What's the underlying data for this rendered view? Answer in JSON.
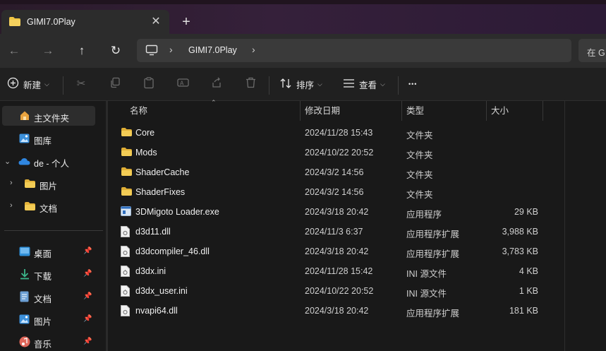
{
  "tab": {
    "title": "GIMI7.0Play",
    "close": "✕",
    "new_tab": "+"
  },
  "nav": {
    "back": "←",
    "forward": "→",
    "up": "↑",
    "refresh": "↻"
  },
  "address": {
    "crumb": "GIMI7.0Play",
    "sep": "›",
    "search_placeholder": "在 G"
  },
  "toolbar": {
    "new_label": "新建",
    "sort_label": "排序",
    "view_label": "查看",
    "more": "•••"
  },
  "sidebar": {
    "items": [
      {
        "label": "主文件夹",
        "icon": "home-icon"
      },
      {
        "label": "图库",
        "icon": "gallery-icon"
      },
      {
        "label": "de - 个人",
        "icon": "cloud-icon"
      },
      {
        "label": "图片",
        "icon": "folder-icon"
      },
      {
        "label": "文档",
        "icon": "folder-icon"
      },
      {
        "label": "桌面",
        "icon": "desktop-icon"
      },
      {
        "label": "下载",
        "icon": "download-icon"
      },
      {
        "label": "文档",
        "icon": "document-icon"
      },
      {
        "label": "图片",
        "icon": "picture-icon"
      },
      {
        "label": "音乐",
        "icon": "music-icon"
      }
    ]
  },
  "columns": {
    "name": "名称",
    "modified": "修改日期",
    "type": "类型",
    "size": "大小"
  },
  "files": [
    {
      "name": "Core",
      "date": "2024/11/28 15:43",
      "type": "文件夹",
      "size": "",
      "kind": "folder"
    },
    {
      "name": "Mods",
      "date": "2024/10/22 20:52",
      "type": "文件夹",
      "size": "",
      "kind": "folder"
    },
    {
      "name": "ShaderCache",
      "date": "2024/3/2 14:56",
      "type": "文件夹",
      "size": "",
      "kind": "folder"
    },
    {
      "name": "ShaderFixes",
      "date": "2024/3/2 14:56",
      "type": "文件夹",
      "size": "",
      "kind": "folder"
    },
    {
      "name": "3DMigoto Loader.exe",
      "date": "2024/3/18 20:42",
      "type": "应用程序",
      "size": "29 KB",
      "kind": "exe"
    },
    {
      "name": "d3d11.dll",
      "date": "2024/11/3 6:37",
      "type": "应用程序扩展",
      "size": "3,988 KB",
      "kind": "dll"
    },
    {
      "name": "d3dcompiler_46.dll",
      "date": "2024/3/18 20:42",
      "type": "应用程序扩展",
      "size": "3,783 KB",
      "kind": "dll"
    },
    {
      "name": "d3dx.ini",
      "date": "2024/11/28 15:42",
      "type": "INI 源文件",
      "size": "4 KB",
      "kind": "ini"
    },
    {
      "name": "d3dx_user.ini",
      "date": "2024/10/22 20:52",
      "type": "INI 源文件",
      "size": "1 KB",
      "kind": "ini"
    },
    {
      "name": "nvapi64.dll",
      "date": "2024/3/18 20:42",
      "type": "应用程序扩展",
      "size": "181 KB",
      "kind": "dll"
    }
  ],
  "colors": {
    "folder": "#f0c543",
    "accent": "#4aa3ff"
  }
}
